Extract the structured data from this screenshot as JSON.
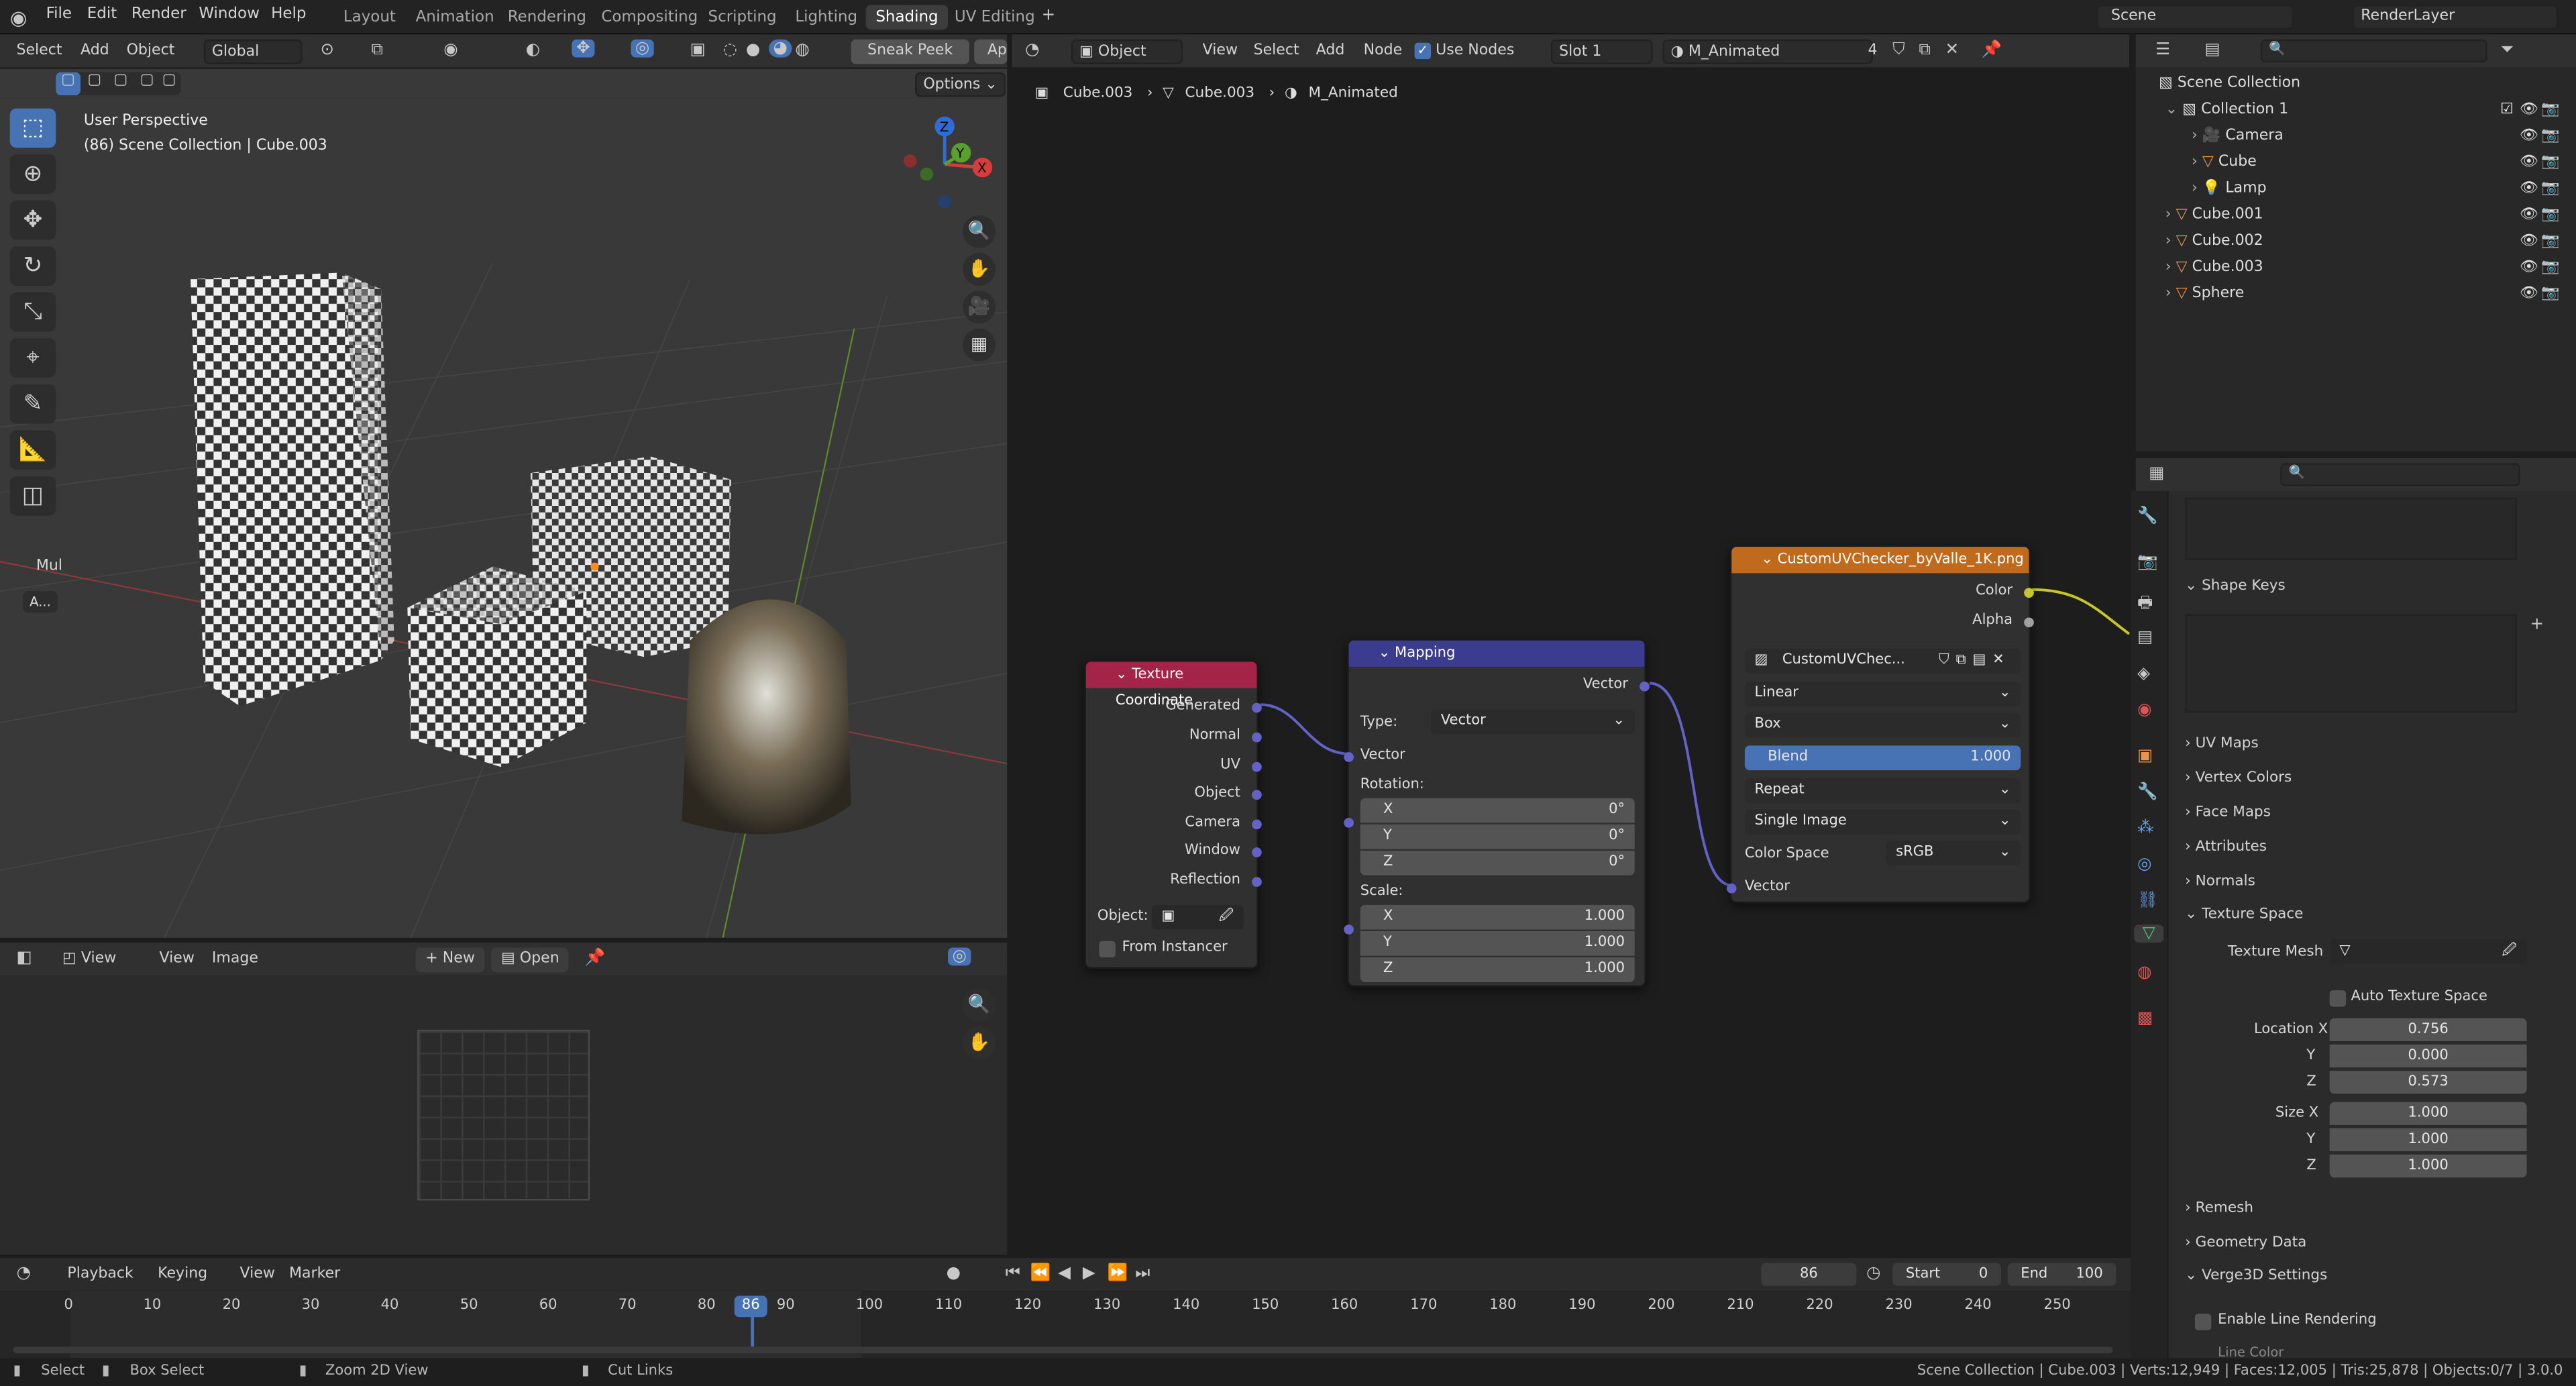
{
  "menus": [
    "File",
    "Edit",
    "Render",
    "Window",
    "Help"
  ],
  "workspaces": [
    "Layout",
    "Animation",
    "Rendering",
    "Compositing",
    "Scripting",
    "Lighting",
    "Shading",
    "UV Editing"
  ],
  "active_workspace": "Shading",
  "scene_name": "Scene",
  "view_layer": "RenderLayer",
  "viewport": {
    "header": {
      "select": "Select",
      "add": "Add",
      "object": "Object",
      "orientation": "Global",
      "sneak_peek": "Sneak Peek",
      "ap": "Ap",
      "options": "Options"
    },
    "perspective": "User Perspective",
    "collection_info": "(86) Scene Collection | Cube.003",
    "mul_label": "Mul",
    "a_label": "A..."
  },
  "image_editor": {
    "view": "View",
    "view2": "View",
    "image": "Image",
    "new": "New",
    "open": "Open"
  },
  "node_editor": {
    "header": {
      "mode": "Object",
      "view": "View",
      "select": "Select",
      "add": "Add",
      "node": "Node",
      "use_nodes": "Use Nodes",
      "slot": "Slot 1",
      "material": "M_Animated",
      "users": "4"
    },
    "breadcrumb": [
      "Cube.003",
      "Cube.003",
      "M_Animated"
    ],
    "texcoord": {
      "title": "Texture Coordinate",
      "outputs": [
        "Generated",
        "Normal",
        "UV",
        "Object",
        "Camera",
        "Window",
        "Reflection"
      ],
      "object_label": "Object:",
      "from_instancer": "From Instancer"
    },
    "mapping": {
      "title": "Mapping",
      "output": "Vector",
      "type_label": "Type:",
      "type_value": "Vector",
      "vector_in": "Vector",
      "rotation": "Rotation:",
      "rx": "X",
      "ry": "Y",
      "rz": "Z",
      "rxv": "0°",
      "ryv": "0°",
      "rzv": "0°",
      "scale": "Scale:",
      "sx": "X",
      "sy": "Y",
      "sz": "Z",
      "sxv": "1.000",
      "syv": "1.000",
      "szv": "1.000"
    },
    "image": {
      "title": "CustomUVChecker_byValle_1K.png",
      "color": "Color",
      "alpha": "Alpha",
      "image_name": "CustomUVChec...",
      "interp": "Linear",
      "proj": "Box",
      "blend_label": "Blend",
      "blend_value": "1.000",
      "ext": "Repeat",
      "source": "Single Image",
      "cs_label": "Color Space",
      "cs_value": "sRGB",
      "vector": "Vector"
    }
  },
  "outliner": {
    "root": "Scene Collection",
    "items": [
      {
        "name": "Collection 1",
        "indent": 1
      },
      {
        "name": "Camera",
        "indent": 2
      },
      {
        "name": "Cube",
        "indent": 2
      },
      {
        "name": "Lamp",
        "indent": 2
      },
      {
        "name": "Cube.001",
        "indent": 1
      },
      {
        "name": "Cube.002",
        "indent": 1
      },
      {
        "name": "Cube.003",
        "indent": 1
      },
      {
        "name": "Sphere",
        "indent": 1
      }
    ]
  },
  "properties": {
    "shape_keys": "Shape Keys",
    "uv_maps": "UV Maps",
    "vertex_colors": "Vertex Colors",
    "face_maps": "Face Maps",
    "attributes": "Attributes",
    "normals": "Normals",
    "texture_space": "Texture Space",
    "texture_mesh": "Texture Mesh",
    "auto_texture_space": "Auto Texture Space",
    "location_x_label": "Location X",
    "y_label": "Y",
    "z_label": "Z",
    "loc_x": "0.756",
    "loc_y": "0.000",
    "loc_z": "0.573",
    "size_x_label": "Size X",
    "size_x": "1.000",
    "size_y": "1.000",
    "size_z": "1.000",
    "remesh": "Remesh",
    "geometry_data": "Geometry Data",
    "verge": "Verge3D Settings",
    "line_rendering": "Enable Line Rendering",
    "line_color": "Line Color"
  },
  "timeline": {
    "playback": "Playback",
    "keying": "Keying",
    "view": "View",
    "marker": "Marker",
    "current_frame": "86",
    "start_label": "Start",
    "start": "0",
    "end_label": "End",
    "end": "100",
    "ticks": [
      "0",
      "10",
      "20",
      "30",
      "40",
      "50",
      "60",
      "70",
      "80",
      "90",
      "100",
      "110",
      "120",
      "130",
      "140",
      "150",
      "160",
      "170",
      "180",
      "190",
      "200",
      "210",
      "220",
      "230",
      "240",
      "250"
    ]
  },
  "status": {
    "select": "Select",
    "box_select": "Box Select",
    "zoom": "Zoom 2D View",
    "cut": "Cut Links",
    "stats": "Scene Collection | Cube.003 | Verts:12,949 | Faces:12,005 | Tris:25,878 | Objects:0/7 | 3.0.0"
  },
  "colors": {
    "accent": "#4772b3",
    "texcoord_header": "#a32447",
    "mapping_header": "#3b3b8f",
    "image_header": "#c06a1d",
    "socket_vector": "#6363c7",
    "socket_color": "#c7c729"
  }
}
